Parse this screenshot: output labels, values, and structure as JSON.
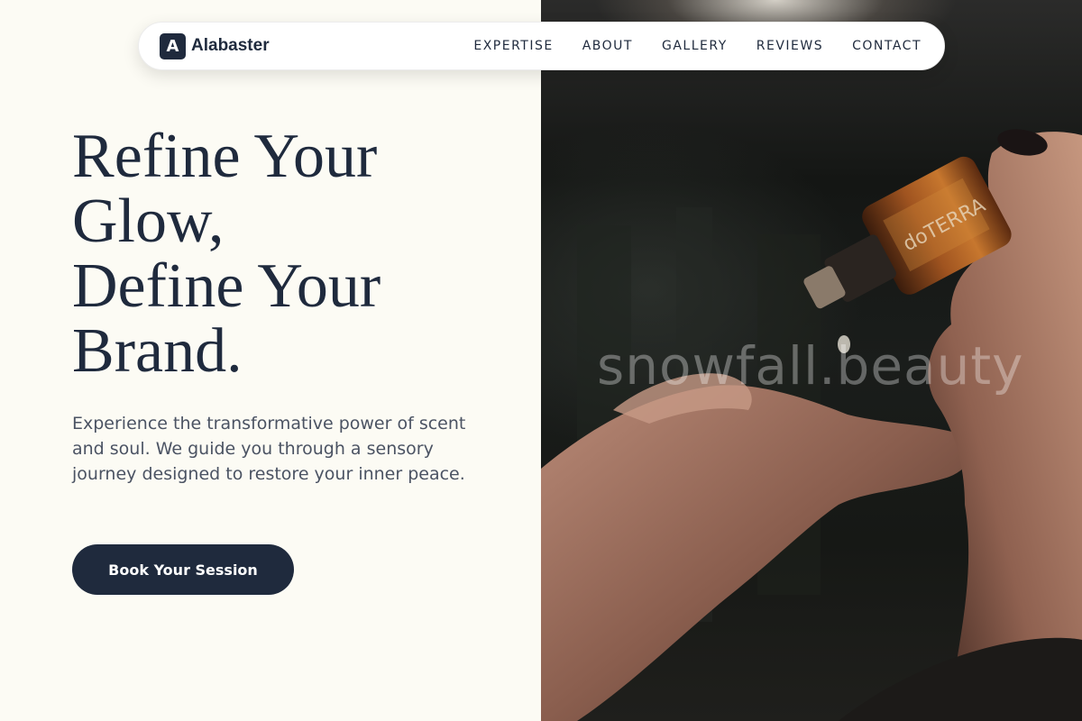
{
  "nav": {
    "brand_mark": "A",
    "brand_name": "Alabaster",
    "links": [
      "EXPERTISE",
      "ABOUT",
      "GALLERY",
      "REVIEWS",
      "CONTACT"
    ]
  },
  "hero": {
    "title_lines": [
      "Refine Your",
      "Glow,",
      "Define Your",
      "Brand."
    ],
    "description": "Experience the transformative power of scent and soul. We guide you through a sensory journey designed to restore your inner peace.",
    "cta_label": "Book Your Session",
    "image_watermark": "snowfall.beauty",
    "bottle_label": "doTERRA"
  },
  "colors": {
    "background": "#fcfbf4",
    "primary": "#1f2a3d",
    "body_text": "#4b5363"
  }
}
